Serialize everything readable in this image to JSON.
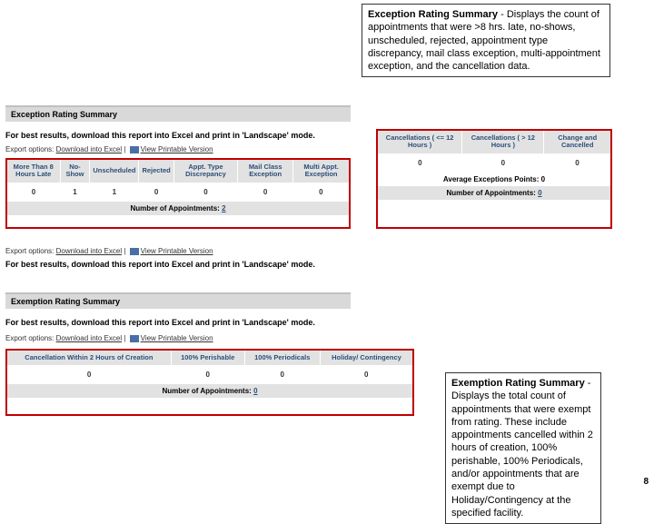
{
  "callouts": {
    "top": {
      "title": "Exception Rating Summary",
      "body": " - Displays the count of appointments that were >8 hrs. late, no-shows, unscheduled, rejected, appointment type discrepancy, mail class exception, multi-appointment exception, and the cancellation data."
    },
    "bottom": {
      "title": "Exemption Rating Summary",
      "body": " - Displays the total count of appointments that were exempt from rating. These include appointments cancelled within 2 hours of creation, 100% perishable, 100% Periodicals, and/or appointments that are exempt due to Holiday/Contingency at the specified facility."
    }
  },
  "ribbons": {
    "r1": "Exception Rating Summary",
    "r2": "Exemption Rating Summary"
  },
  "instr": "For best results, download this report into Excel and print in 'Landscape' mode.",
  "export": {
    "label": "Export options:",
    "excel": "Download into Excel",
    "print": "View Printable Version"
  },
  "left_table": {
    "headers": [
      "More Than 8 Hours Late",
      "No-Show",
      "Unscheduled",
      "Rejected",
      "Appt. Type Discrepancy",
      "Mail Class Exception",
      "Multi Appt. Exception"
    ],
    "row": [
      "0",
      "1",
      "1",
      "0",
      "0",
      "0",
      "0"
    ],
    "footer_label": "Number of Appointments:",
    "footer_val": "2"
  },
  "right_table": {
    "headers": [
      "Cancellations ( <= 12 Hours )",
      "Cancellations ( > 12 Hours )",
      "Change and Cancelled"
    ],
    "row": [
      "0",
      "0",
      "0"
    ],
    "avg": "Average Exceptions Points: 0",
    "footer_label": "Number of Appointments:",
    "footer_val": "0"
  },
  "bottom_table": {
    "headers": [
      "Cancellation Within 2 Hours of Creation",
      "100% Perishable",
      "100% Periodicals",
      "Holiday/ Contingency"
    ],
    "row": [
      "0",
      "0",
      "0",
      "0"
    ],
    "footer_label": "Number of Appointments:",
    "footer_val": "0"
  },
  "page": "8"
}
